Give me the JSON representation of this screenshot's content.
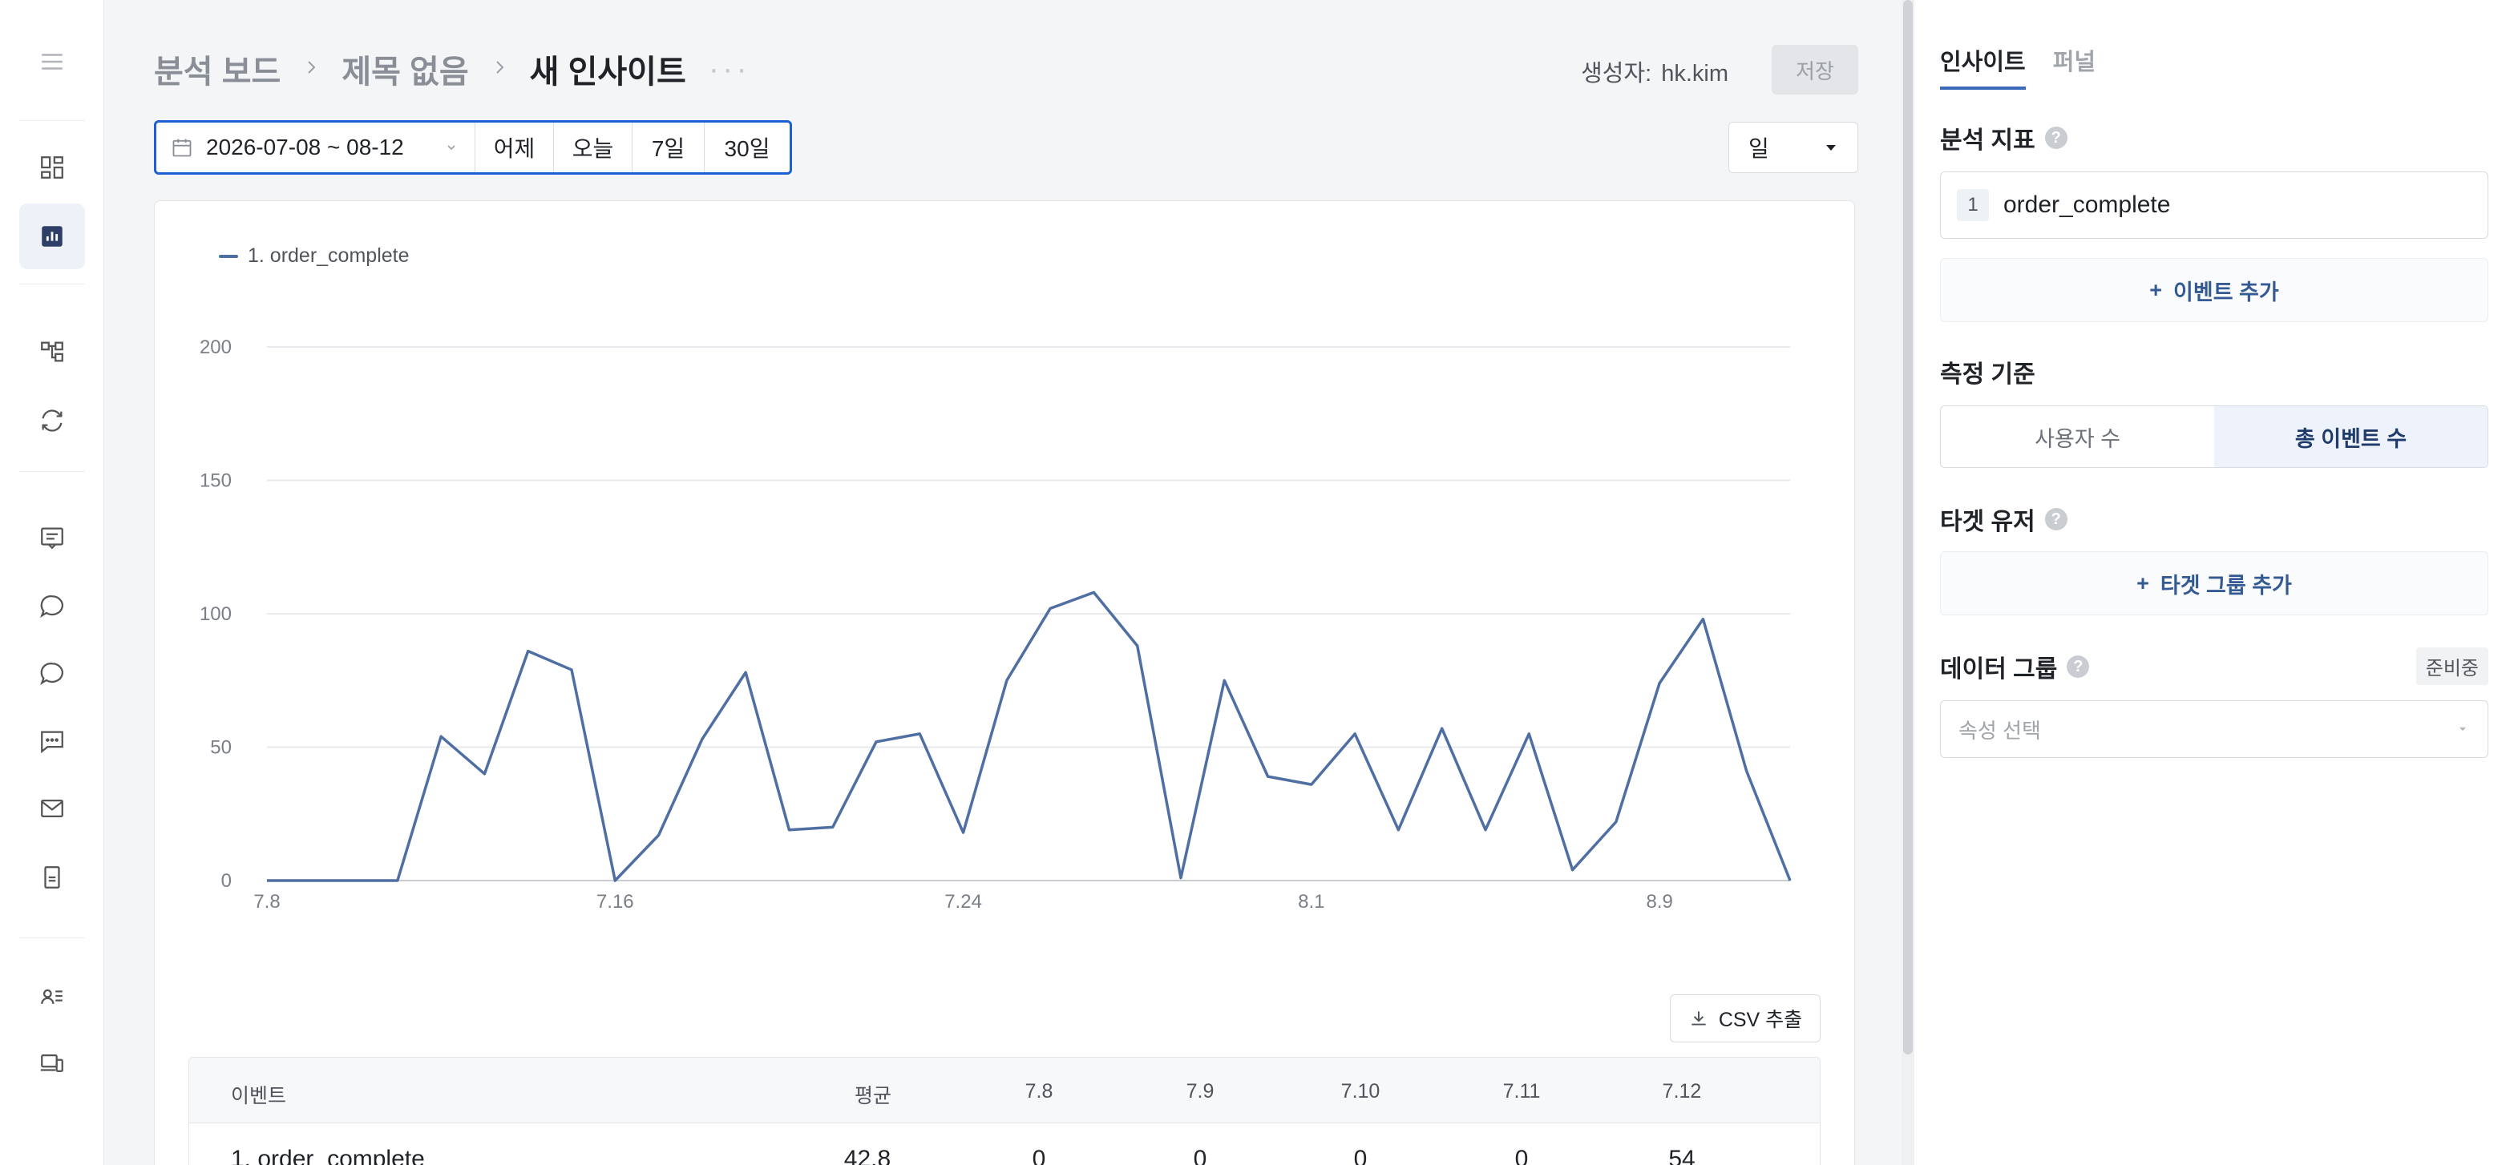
{
  "rail": {
    "icons": [
      "menu-icon",
      "dashboard-icon",
      "chart-icon",
      "flow-icon",
      "refresh-icon",
      "board-icon",
      "chat-icon",
      "chat-alt-icon",
      "message-icon",
      "mail-icon",
      "document-icon",
      "user-list-icon",
      "devices-icon"
    ],
    "active": "chart-icon"
  },
  "header": {
    "breadcrumb": [
      "분석 보드",
      "제목 없음",
      "새 인사이트"
    ],
    "more": "···",
    "creator_label": "생성자:",
    "creator_name": "hk.kim",
    "save_label": "저장"
  },
  "filters": {
    "date_range": "2026-07-08 ~ 08-12",
    "quick_ranges": [
      "어제",
      "오늘",
      "7일",
      "30일"
    ],
    "period": "일"
  },
  "chart_data": {
    "type": "line",
    "series": [
      {
        "name": "1. order_complete",
        "color": "#4f6fa3",
        "values": [
          0,
          0,
          0,
          0,
          54,
          40,
          86,
          79,
          0,
          17,
          53,
          78,
          19,
          20,
          52,
          55,
          18,
          75,
          102,
          108,
          88,
          1,
          75,
          39,
          36,
          55,
          19,
          57,
          19,
          55,
          4,
          22,
          74,
          98,
          41,
          0
        ]
      }
    ],
    "x_ticks": [
      "7.8",
      "7.16",
      "7.24",
      "8.1",
      "8.9"
    ],
    "x_tick_index": [
      0,
      8,
      16,
      24,
      32
    ],
    "y_ticks": [
      0,
      50,
      100,
      150,
      200
    ],
    "ylim": [
      0,
      200
    ],
    "grid": true,
    "legend_position": "top-left"
  },
  "csv_label": "CSV 추출",
  "table": {
    "headers": [
      "이벤트",
      "평균",
      "7.8",
      "7.9",
      "7.10",
      "7.11",
      "7.12"
    ],
    "rows": [
      [
        "1. order_complete",
        "42.8",
        "0",
        "0",
        "0",
        "0",
        "54"
      ]
    ]
  },
  "panel": {
    "tabs": [
      "인사이트",
      "퍼널"
    ],
    "metric_title": "분석 지표",
    "metric_index": "1",
    "metric_name": "order_complete",
    "add_event": "이벤트 추가",
    "measure_title": "측정 기준",
    "measure_options": [
      "사용자 수",
      "총 이벤트 수"
    ],
    "target_title": "타겟 유저",
    "add_target": "타겟 그룹 추가",
    "data_group_title": "데이터 그룹",
    "data_group_badge": "준비중",
    "attr_placeholder": "속성 선택",
    "help": "?",
    "plus": "+"
  }
}
